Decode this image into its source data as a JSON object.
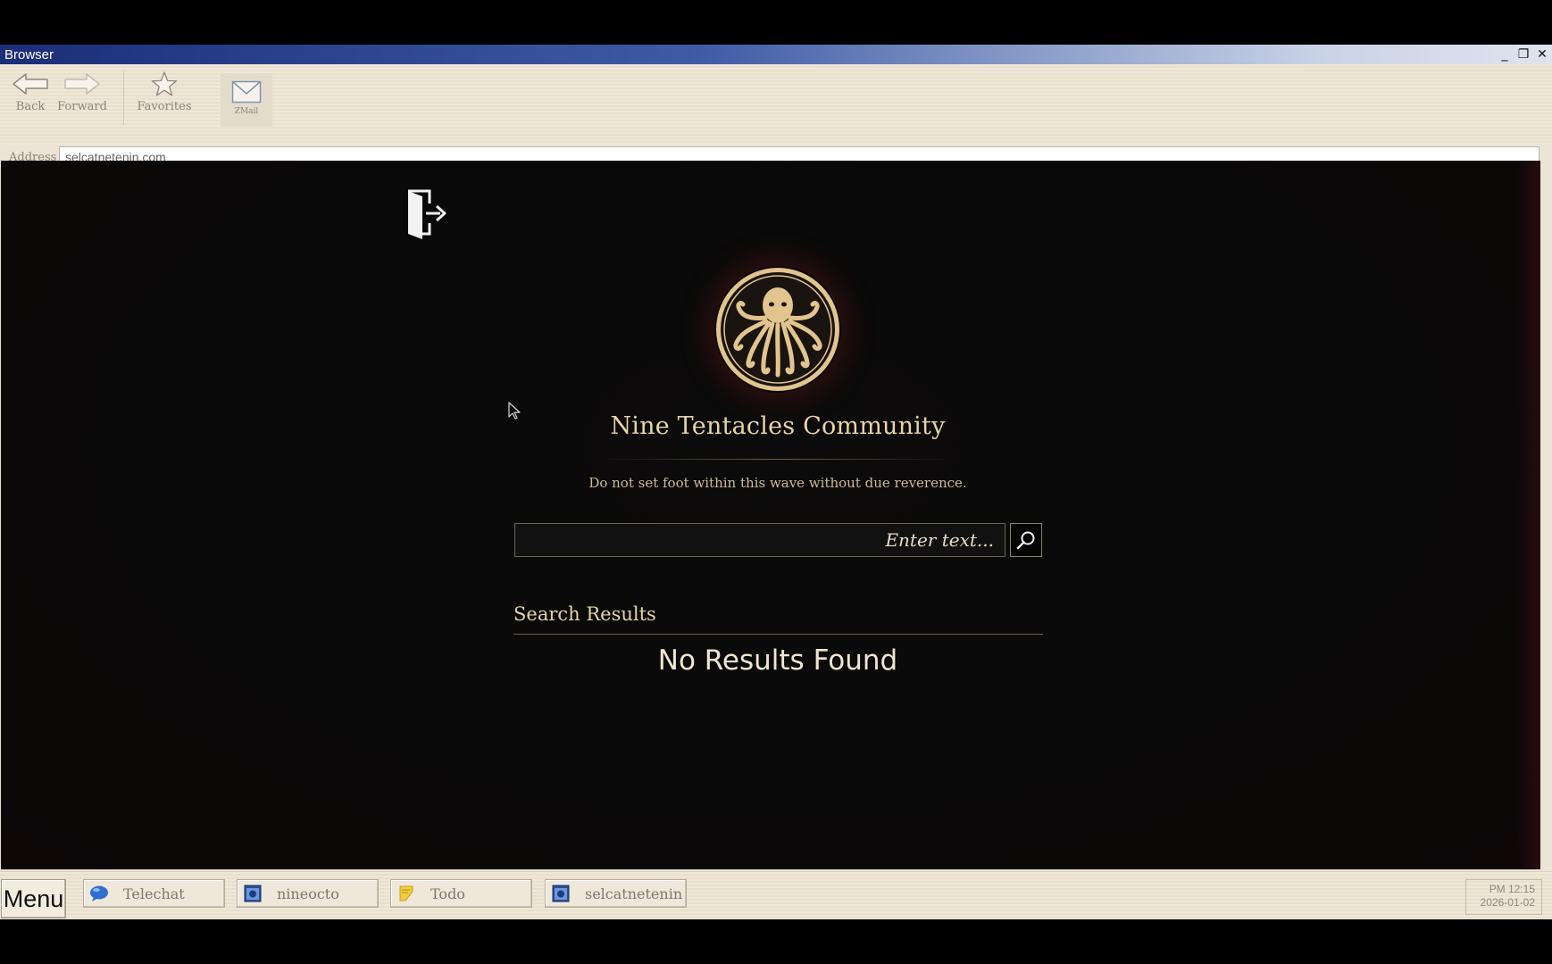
{
  "window": {
    "title": "Browser",
    "controls": {
      "minimize": "_",
      "restore": "❐",
      "close": "✕"
    }
  },
  "toolbar": {
    "back_label": "Back",
    "forward_label": "Forward",
    "favorites_label": "Favorites",
    "zmail_label": "ZMail"
  },
  "address": {
    "label": "Address",
    "value": "selcatnetenin.com"
  },
  "page": {
    "site_title": "Nine Tentacles Community",
    "tagline": "Do not set foot within this wave without due reverence.",
    "search": {
      "placeholder": "Enter text...",
      "value": ""
    },
    "results_heading": "Search Results",
    "no_results": "No Results Found",
    "colors": {
      "gold": "#e6d3a6",
      "background": "#0a0909"
    }
  },
  "taskbar": {
    "menu_label": "Menu",
    "items": [
      {
        "label": "Telechat",
        "icon": "chat-bubble-icon"
      },
      {
        "label": "nineocto",
        "icon": "browser-window-icon"
      },
      {
        "label": "Todo",
        "icon": "note-icon"
      },
      {
        "label": "selcatnetenin",
        "icon": "browser-window-icon"
      }
    ],
    "clock": {
      "time": "PM 12:15",
      "date": "2026-01-02"
    }
  }
}
